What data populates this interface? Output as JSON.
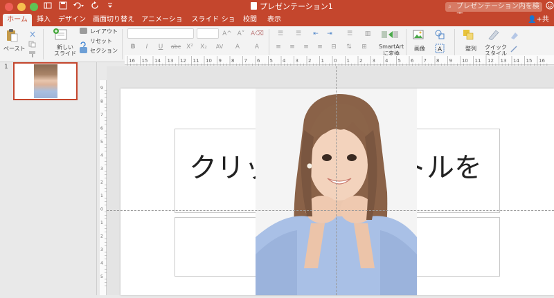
{
  "window": {
    "title": "プレゼンテーション1",
    "search_placeholder": "プレゼンテーション内を検索",
    "share_label": "共有"
  },
  "tabs": [
    {
      "label": "ホーム",
      "active": true
    },
    {
      "label": "挿入"
    },
    {
      "label": "デザイン"
    },
    {
      "label": "画面切り替え"
    },
    {
      "label": "アニメーション"
    },
    {
      "label": "スライド ショー"
    },
    {
      "label": "校閲"
    },
    {
      "label": "表示"
    }
  ],
  "ribbon": {
    "paste": "ペースト",
    "new_slide_line1": "新しい",
    "new_slide_line2": "スライド",
    "layout": "レイアウト",
    "reset": "リセット",
    "section": "セクション",
    "smartart_line1": "SmartArt",
    "smartart_line2": "に変換",
    "picture": "画像",
    "arrange": "整列",
    "quick_style_line1": "クイック",
    "quick_style_line2": "スタイル",
    "format_buttons": [
      "B",
      "I",
      "U",
      "abc",
      "X²",
      "X₂"
    ]
  },
  "slides_panel": {
    "slide_number": "1"
  },
  "rulers": {
    "h_labels": [
      "16",
      "15",
      "14",
      "13",
      "12",
      "11",
      "10",
      "9",
      "8",
      "7",
      "6",
      "5",
      "4",
      "3",
      "2",
      "1",
      "0",
      "1",
      "2",
      "3",
      "4",
      "5",
      "6",
      "7",
      "8",
      "9",
      "10",
      "11",
      "12",
      "13",
      "14",
      "15",
      "16"
    ],
    "v_labels": [
      "9",
      "8",
      "7",
      "6",
      "5",
      "4",
      "3",
      "2",
      "1",
      "0",
      "1",
      "2",
      "3",
      "4",
      "5"
    ]
  },
  "slide": {
    "title_left": "クリッ",
    "title_right": "トルを"
  },
  "colors": {
    "accent": "#c4462d",
    "ribbon_bg": "#f3f3f3"
  }
}
